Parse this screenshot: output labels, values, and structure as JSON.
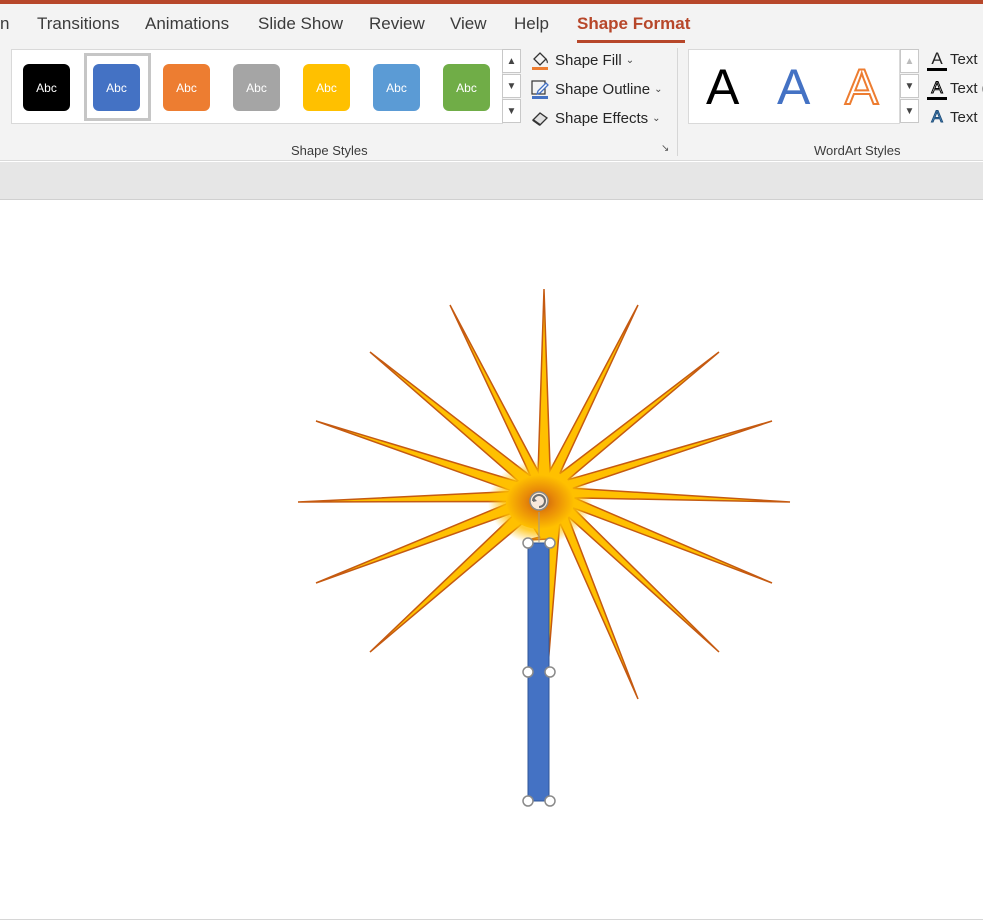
{
  "ribbon_tabs": [
    {
      "label": "n",
      "active": false
    },
    {
      "label": "Transitions",
      "active": false
    },
    {
      "label": "Animations",
      "active": false
    },
    {
      "label": "Slide Show",
      "active": false
    },
    {
      "label": "Review",
      "active": false
    },
    {
      "label": "View",
      "active": false
    },
    {
      "label": "Help",
      "active": false
    },
    {
      "label": "Shape Format",
      "active": true
    }
  ],
  "shape_styles": {
    "label": "Shape Styles",
    "items": [
      {
        "text": "Abc",
        "color": "#000000"
      },
      {
        "text": "Abc",
        "color": "#4472c4",
        "selected": true
      },
      {
        "text": "Abc",
        "color": "#ed7d31"
      },
      {
        "text": "Abc",
        "color": "#a5a5a5"
      },
      {
        "text": "Abc",
        "color": "#ffc000"
      },
      {
        "text": "Abc",
        "color": "#5b9bd5"
      },
      {
        "text": "Abc",
        "color": "#70ad47"
      }
    ]
  },
  "shape_commands": {
    "fill": "Shape Fill",
    "outline": "Shape Outline",
    "effects": "Shape Effects"
  },
  "wordart": {
    "label": "WordArt Styles",
    "letters": [
      {
        "text": "A",
        "style": "black"
      },
      {
        "text": "A",
        "style": "blue-gradient"
      },
      {
        "text": "A",
        "style": "orange-outline"
      }
    ],
    "text_fill": "Text",
    "text_outline": "Text (",
    "text_effects": "Text"
  },
  "colors": {
    "accent": "#b7472a",
    "sun_fill": "#ffc000",
    "sun_outline": "#c55a11",
    "stick_fill": "#4472c4"
  },
  "slide_shapes": {
    "sun": "sun-burst-shape",
    "stick": "blue-rectangle-shape"
  }
}
